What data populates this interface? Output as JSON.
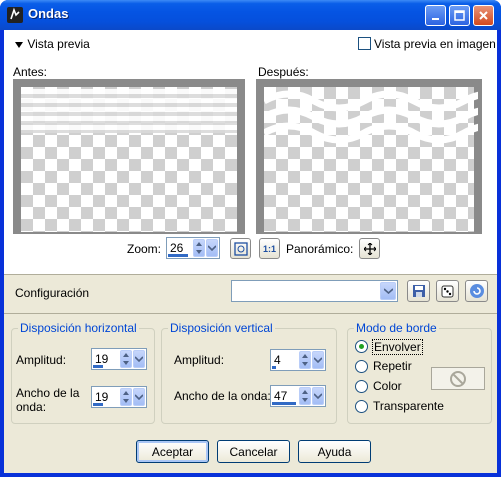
{
  "window": {
    "title": "Ondas"
  },
  "preview": {
    "toggle_label": "Vista previa",
    "in_image_label": "Vista previa en imagen",
    "before_label": "Antes:",
    "after_label": "Después:",
    "zoom_label": "Zoom:",
    "zoom_value": "26",
    "pan_label": "Panorámico:",
    "one_to_one_label": "1:1"
  },
  "config": {
    "label": "Configuración",
    "value": ""
  },
  "horizontal": {
    "title": "Disposición horizontal",
    "amplitude_label": "Amplitud:",
    "amplitude_value": "19",
    "wavelength_label": "Ancho de la onda:",
    "wavelength_value": "19"
  },
  "vertical": {
    "title": "Disposición vertical",
    "amplitude_label": "Amplitud:",
    "amplitude_value": "4",
    "wavelength_label": "Ancho de la onda:",
    "wavelength_value": "47"
  },
  "edge": {
    "title": "Modo de borde",
    "options": [
      "Envolver",
      "Repetir",
      "Color",
      "Transparente"
    ],
    "selected": "Envolver"
  },
  "buttons": {
    "ok": "Aceptar",
    "cancel": "Cancelar",
    "help": "Ayuda"
  },
  "colors": {
    "title_blue": "#0a5ee8",
    "group_title": "#0046d5",
    "face": "#ece9d8"
  }
}
